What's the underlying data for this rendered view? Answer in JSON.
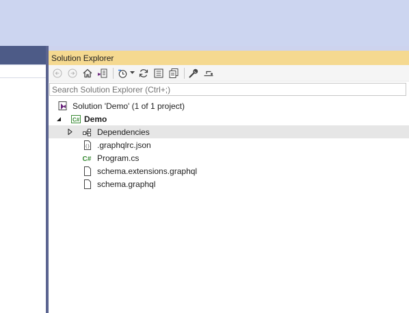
{
  "panel": {
    "title": "Solution Explorer",
    "search_placeholder": "Search Solution Explorer (Ctrl+;)"
  },
  "toolbar": {
    "buttons": [
      {
        "name": "back",
        "icon": "back-arrow-icon"
      },
      {
        "name": "forward",
        "icon": "forward-arrow-icon"
      },
      {
        "name": "home",
        "icon": "home-icon"
      },
      {
        "name": "switch-views",
        "icon": "switch-views-icon"
      },
      {
        "name": "pending-changes-filter",
        "icon": "clock-icon"
      },
      {
        "name": "sync-active-document",
        "icon": "sync-icon"
      },
      {
        "name": "collapse-all",
        "icon": "collapse-all-icon"
      },
      {
        "name": "show-all-files",
        "icon": "show-all-files-icon"
      },
      {
        "name": "properties",
        "icon": "wrench-icon"
      },
      {
        "name": "preview-selected",
        "icon": "preview-icon"
      }
    ]
  },
  "tree": {
    "solution": "Solution 'Demo' (1 of 1 project)",
    "project": "Demo",
    "items": [
      {
        "label": "Dependencies",
        "icon": "dependencies-icon",
        "expander": "collapsed"
      },
      {
        "label": ".graphqlrc.json",
        "icon": "json-file-icon"
      },
      {
        "label": "Program.cs",
        "icon": "csharp-file-icon"
      },
      {
        "label": "schema.extensions.graphql",
        "icon": "file-icon"
      },
      {
        "label": "schema.graphql",
        "icon": "file-icon"
      }
    ]
  },
  "colors": {
    "title_bar": "#f5d990",
    "hover_row": "#e6e6e6",
    "csharp_green": "#388a34",
    "accent_purple": "#68217a"
  }
}
